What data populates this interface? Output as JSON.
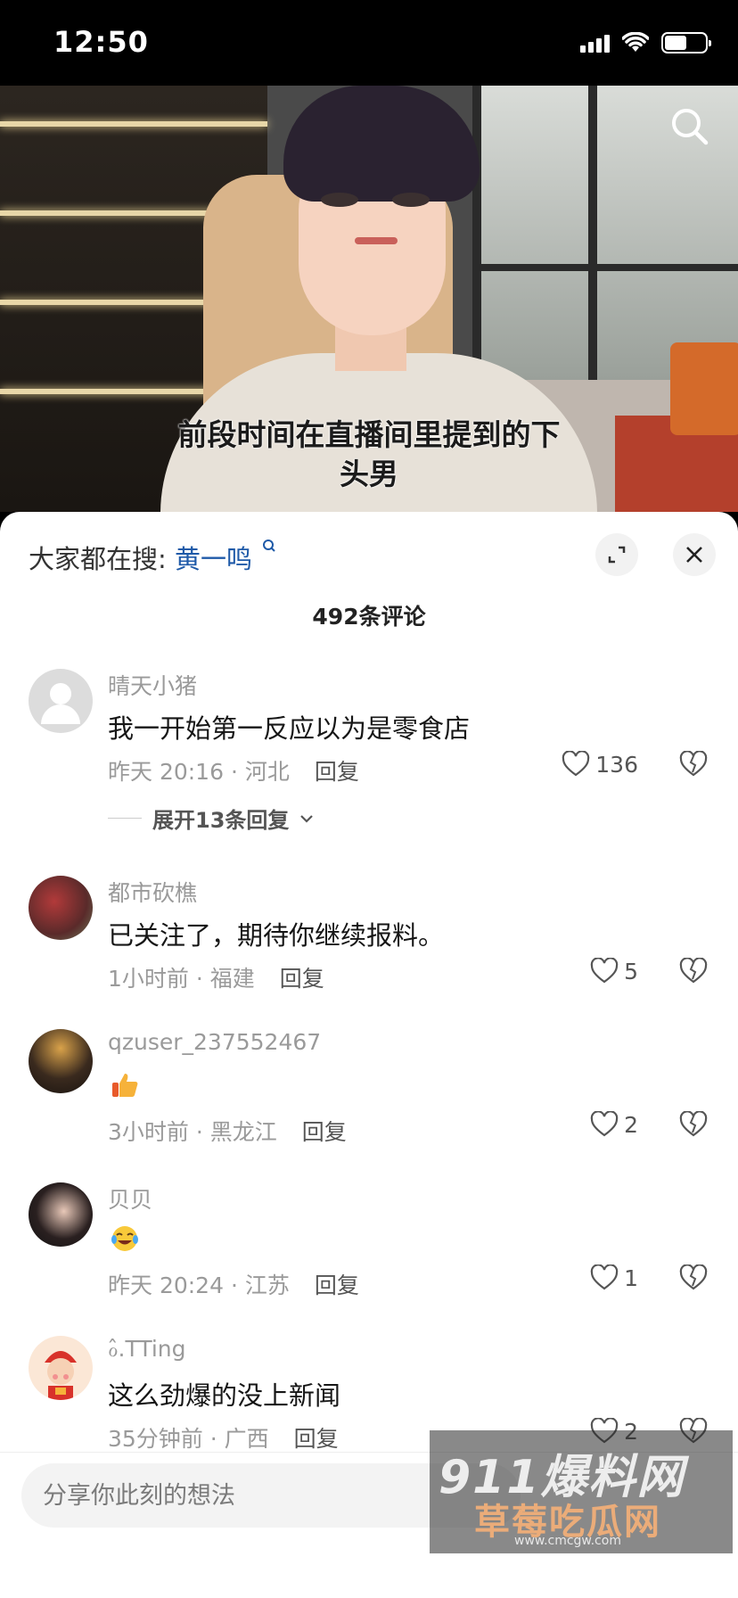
{
  "status_bar": {
    "time": "12:50"
  },
  "video": {
    "caption": "前段时间在直播间里提到的下\n头男"
  },
  "sheet": {
    "trending_label": "大家都在搜:",
    "trending_keyword": "黄一鸣",
    "comment_count": "492条评论",
    "comments": [
      {
        "username": "晴天小猪",
        "text": "我一开始第一反应以为是零食店",
        "meta": "昨天 20:16 · 河北",
        "reply": "回复",
        "likes": "136",
        "expand": "展开13条回复",
        "avatar": "default-avatar"
      },
      {
        "username": "都市砍樵",
        "text": "已关注了，期待你继续报料。",
        "meta": "1小时前 · 福建",
        "reply": "回复",
        "likes": "5",
        "avatar": "plum-blossom-avatar"
      },
      {
        "username": "qzuser_237552467",
        "text": "",
        "emoji": "thumbs-up-emoji",
        "meta": "3小时前 · 黑龙江",
        "reply": "回复",
        "likes": "2",
        "avatar": "street-night-avatar"
      },
      {
        "username": "贝贝",
        "text": "",
        "emoji": "crying-laughing-emoji",
        "meta": "昨天 20:24 · 江苏",
        "reply": "回复",
        "likes": "1",
        "avatar": "girl-avatar"
      },
      {
        "username": "ℴ̂.TTing",
        "text": "这么劲爆的没上新闻",
        "meta": "35分钟前 · 广西",
        "reply": "回复",
        "likes": "2",
        "avatar": "fortune-god-avatar"
      }
    ]
  },
  "input": {
    "placeholder": "分享你此刻的想法"
  },
  "watermark": {
    "line1": "911爆料网",
    "line2": "草莓吃瓜网",
    "line3": "www.cmcgw.com"
  },
  "colors": {
    "keyword": "#1f5aa8",
    "muted": "#9a9a9a"
  }
}
